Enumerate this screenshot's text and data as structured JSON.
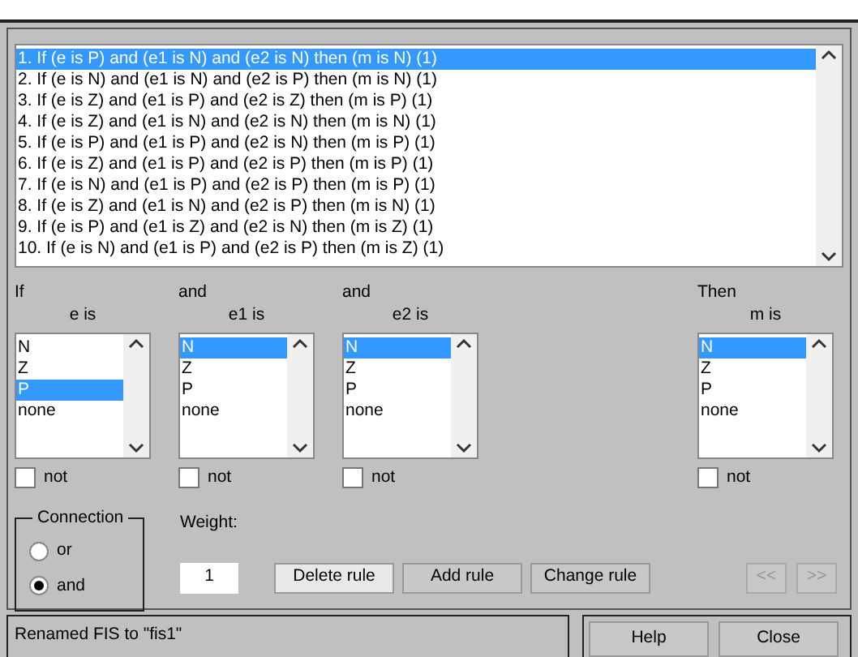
{
  "rules": [
    {
      "text": "1. If (e is P) and (e1 is N) and (e2 is N) then (m is N) (1)",
      "selected": true
    },
    {
      "text": "2. If (e is N) and (e1 is N) and (e2 is P) then (m is N) (1)",
      "selected": false
    },
    {
      "text": "3. If (e is Z) and (e1 is P) and (e2 is Z) then (m is P) (1)",
      "selected": false
    },
    {
      "text": "4. If (e is Z) and (e1 is N) and (e2 is N) then (m is N) (1)",
      "selected": false
    },
    {
      "text": "5. If (e is P) and (e1 is P) and (e2 is N) then (m is P) (1)",
      "selected": false
    },
    {
      "text": "6. If (e is Z) and (e1 is P) and (e2 is P) then (m is P) (1)",
      "selected": false
    },
    {
      "text": "7. If (e is N) and (e1 is P) and (e2 is P) then (m is P) (1)",
      "selected": false
    },
    {
      "text": "8. If (e is Z) and (e1 is N) and (e2 is P) then (m is N) (1)",
      "selected": false
    },
    {
      "text": "9. If (e is P) and (e1 is Z) and (e2 is N) then (m is Z) (1)",
      "selected": false
    },
    {
      "text": "10. If (e is N) and (e1 is P) and (e2 is P) then (m is Z) (1)",
      "selected": false
    }
  ],
  "variables": [
    {
      "heading": "If",
      "label": "e is",
      "items": [
        {
          "text": "N",
          "selected": false
        },
        {
          "text": "Z",
          "selected": false
        },
        {
          "text": "P",
          "selected": true
        },
        {
          "text": "none",
          "selected": false
        }
      ],
      "not_label": "not",
      "not_checked": false
    },
    {
      "heading": "and",
      "label": "e1 is",
      "items": [
        {
          "text": "N",
          "selected": true
        },
        {
          "text": "Z",
          "selected": false
        },
        {
          "text": "P",
          "selected": false
        },
        {
          "text": "none",
          "selected": false
        }
      ],
      "not_label": "not",
      "not_checked": false
    },
    {
      "heading": "and",
      "label": "e2 is",
      "items": [
        {
          "text": "N",
          "selected": true
        },
        {
          "text": "Z",
          "selected": false
        },
        {
          "text": "P",
          "selected": false
        },
        {
          "text": "none",
          "selected": false
        }
      ],
      "not_label": "not",
      "not_checked": false
    },
    {
      "heading": "Then",
      "label": "m is",
      "items": [
        {
          "text": "N",
          "selected": true
        },
        {
          "text": "Z",
          "selected": false
        },
        {
          "text": "P",
          "selected": false
        },
        {
          "text": "none",
          "selected": false
        }
      ],
      "not_label": "not",
      "not_checked": false
    }
  ],
  "connection": {
    "title": "Connection",
    "options": [
      {
        "label": "or",
        "selected": false
      },
      {
        "label": "and",
        "selected": true
      }
    ]
  },
  "weight": {
    "label": "Weight:",
    "value": "1"
  },
  "rule_buttons": [
    {
      "label": "Delete rule",
      "focused": true
    },
    {
      "label": "Add rule",
      "focused": false
    },
    {
      "label": "Change rule",
      "focused": false
    }
  ],
  "nav_buttons": [
    {
      "label": "<<",
      "disabled": true
    },
    {
      "label": ">>",
      "disabled": true
    }
  ],
  "status": "Renamed FIS to \"fis1\"",
  "footer_buttons": [
    "Help",
    "Close"
  ]
}
